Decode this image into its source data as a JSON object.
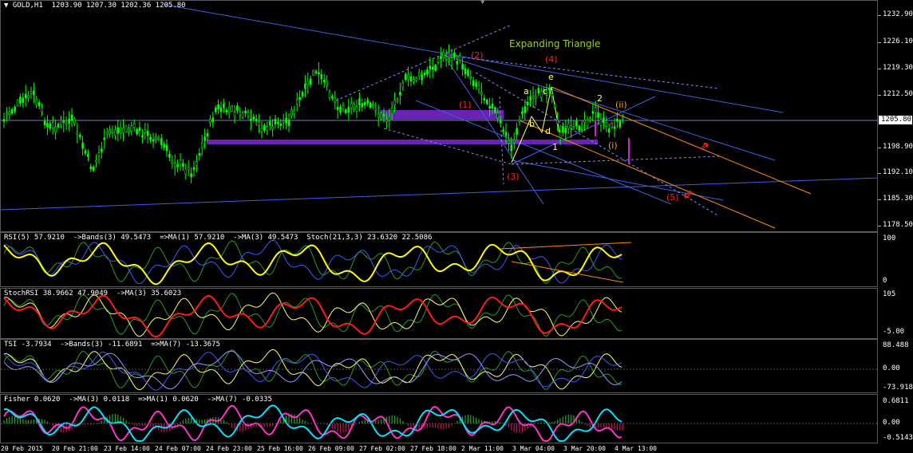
{
  "main": {
    "title": "GOLD,H1  1203.90 1207.30 1202.36 1205.80",
    "current_price": "1205.80",
    "price_ticks": [
      "1232.90",
      "1226.10",
      "1219.30",
      "1212.50",
      "1198.90",
      "1192.10",
      "1185.30",
      "1178.50"
    ],
    "pattern_label": "Expanding Triangle",
    "wave_labels": {
      "w1": "(1)",
      "w2": "(2)",
      "w3": "(3)",
      "w4": "(4)",
      "w5": "(5)",
      "a": "a",
      "b": "b",
      "c": "c",
      "d": "d",
      "e": "e",
      "n1": "1",
      "n2": "2",
      "ii": "(ii)",
      "i": "(i)"
    },
    "colors": {
      "candle": "#00ff00",
      "trend": "#3f5fe0",
      "channel": "#ff8c00",
      "zone": "#6a22b4",
      "wave": "#ff2020",
      "pattern": "#9acd32"
    }
  },
  "rsi": {
    "title": "RSI(5) 57.9210  ->Bands(3) 49.5473  =>MA(1) 57.9210  ->MA(3) 49.5473  Stoch(21,3,3) 23.6320 22.5086",
    "ticks": [
      "100",
      "0"
    ]
  },
  "stochrsi": {
    "title": "StochRSI 38.9662 47.9049  ->MA(3) 35.6023",
    "ticks": [
      "105",
      "-5.00"
    ]
  },
  "tsi": {
    "title": "TSI -3.7934  ->Bands(3) -11.6891  =>MA(7) -13.3675",
    "ticks": [
      "88.488",
      "0.00",
      "-73.9187"
    ]
  },
  "fisher": {
    "title": "Fisher 0.0620  ->MA(3) 0.0118  =>MA(1) 0.0620  ->MA(7) -0.0335",
    "ticks": [
      "0.6811",
      "0.00",
      "-0.5143"
    ]
  },
  "time_labels": [
    "20 Feb 2015",
    "20 Feb 21:00",
    "23 Feb 14:00",
    "24 Feb 07:00",
    "24 Feb 23:00",
    "25 Feb 16:00",
    "26 Feb 09:00",
    "27 Feb 02:00",
    "27 Feb 18:00",
    "2 Mar 11:00",
    "3 Mar 04:00",
    "3 Mar 20:00",
    "4 Mar 13:00"
  ]
}
